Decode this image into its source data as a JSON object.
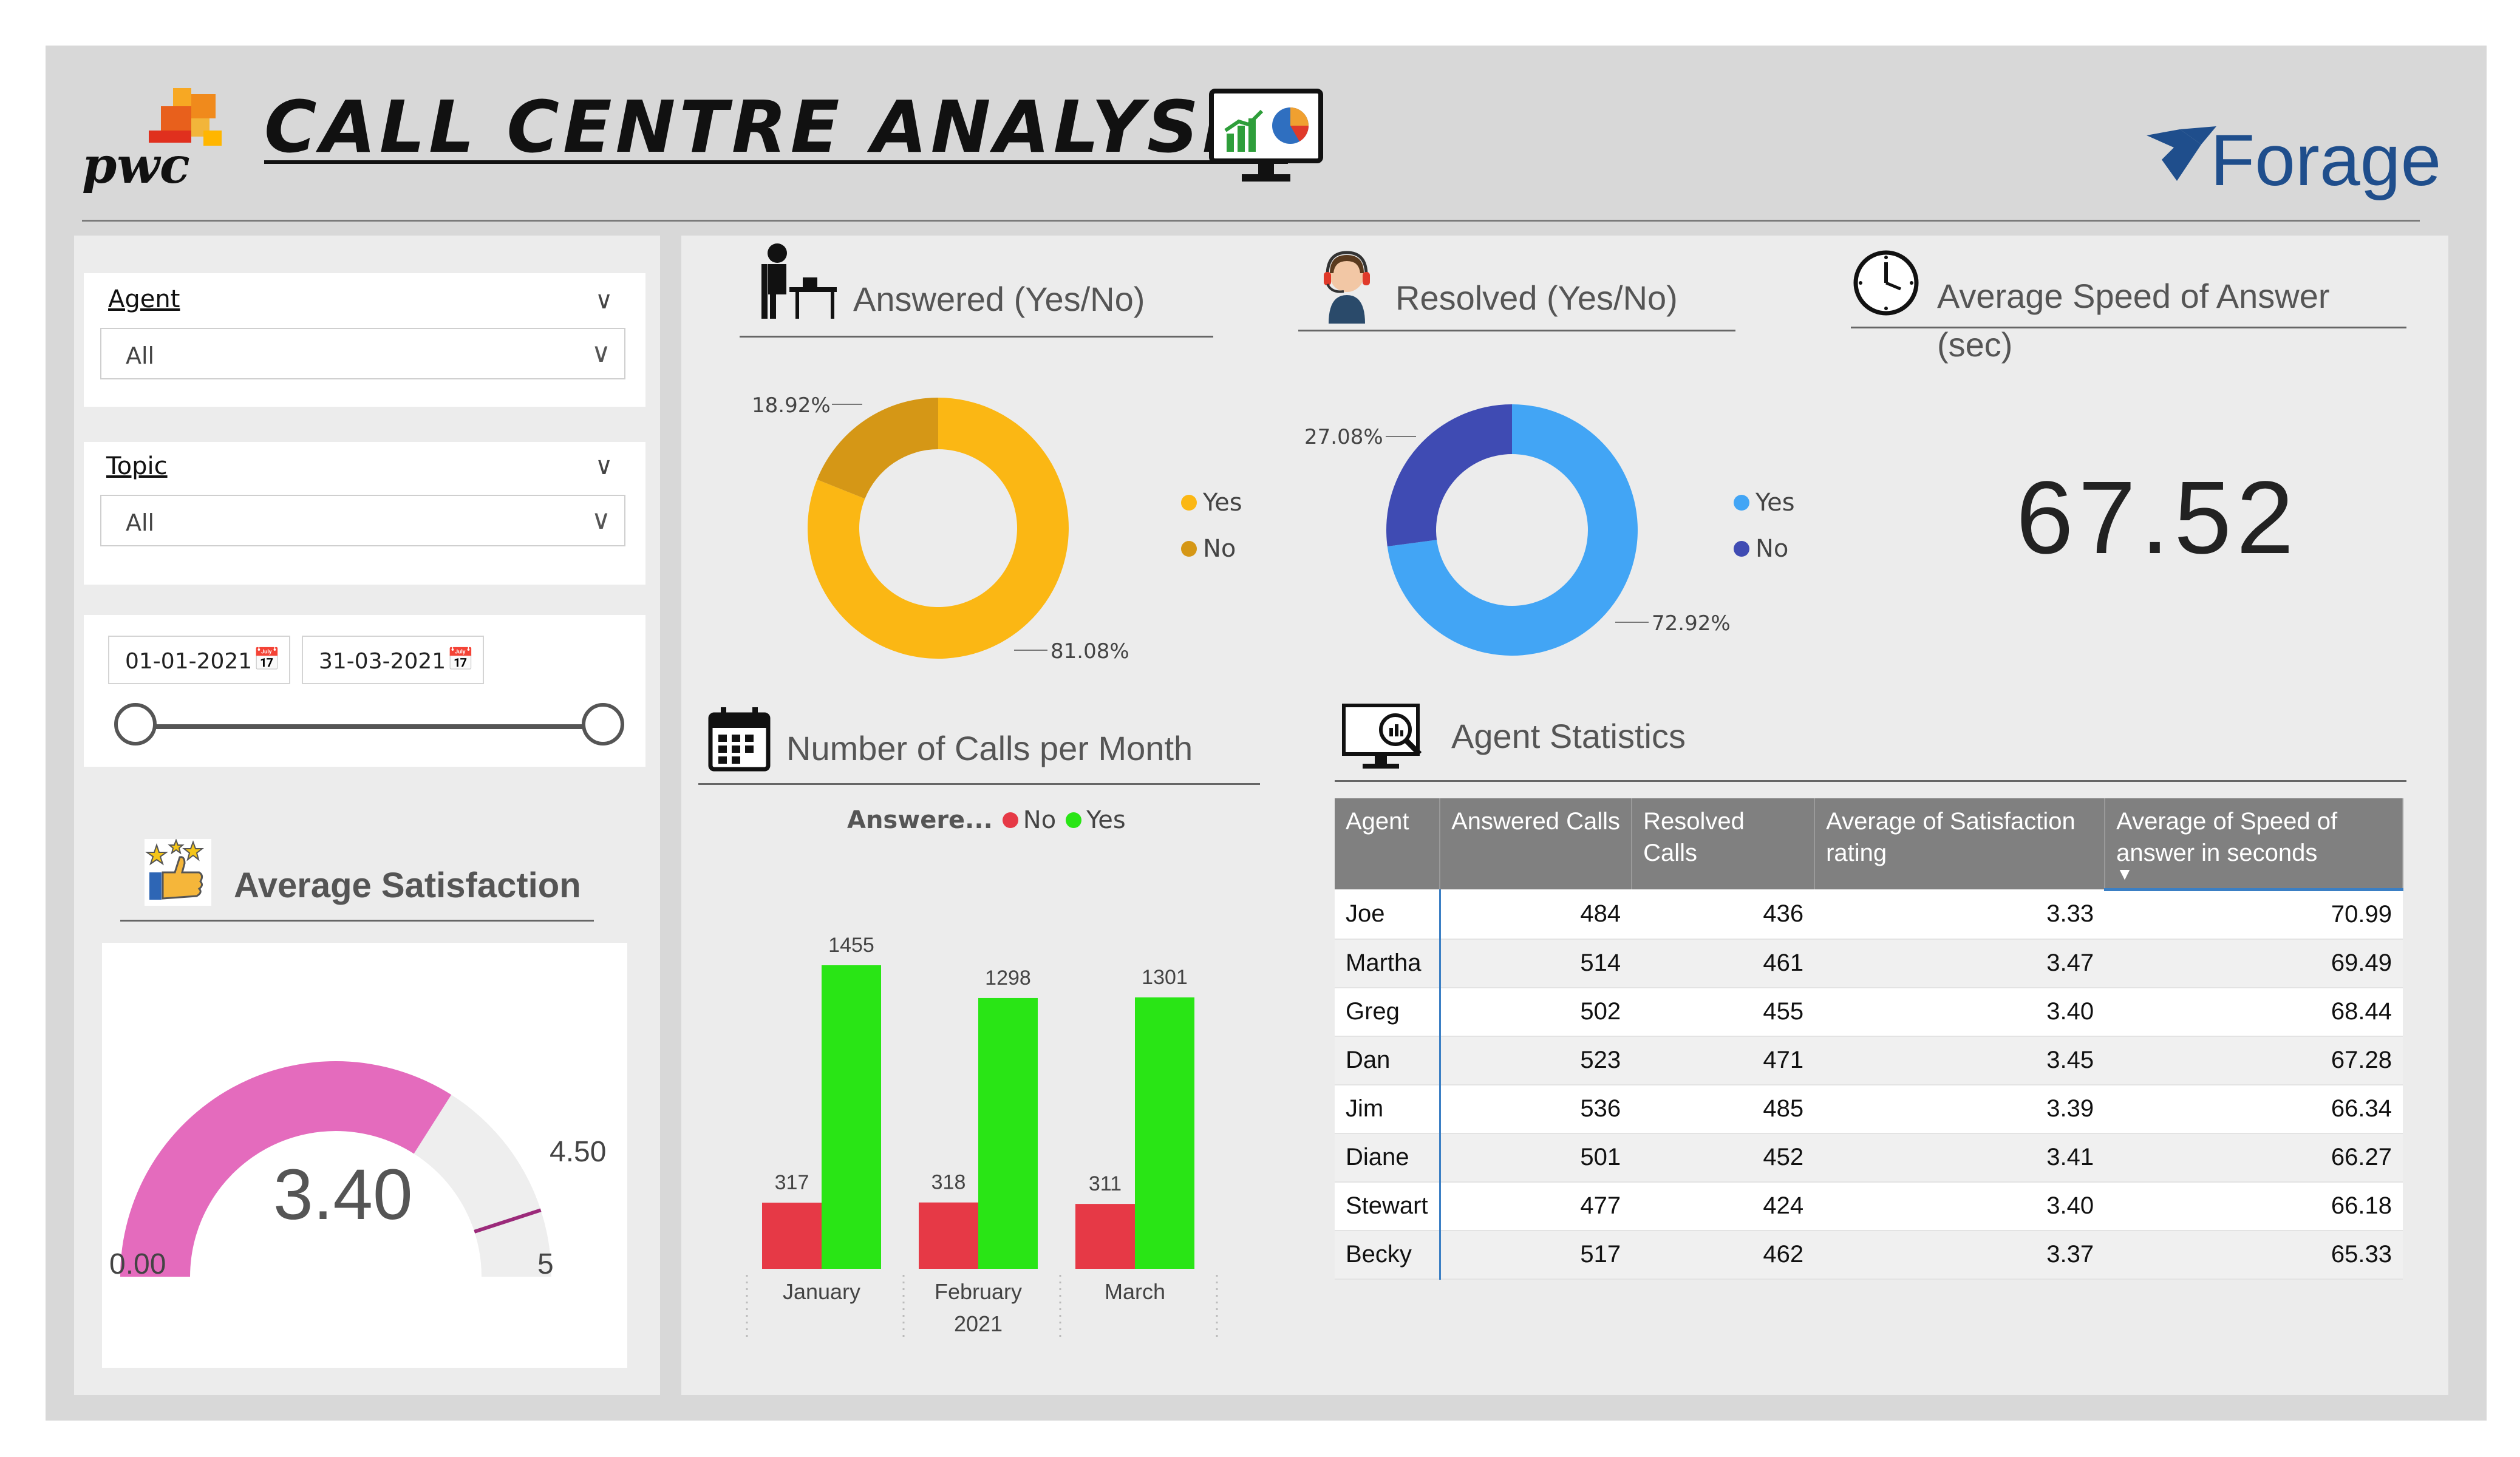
{
  "header": {
    "logo_left": "pwc",
    "title": "CALL CENTRE ANALYSIS",
    "logo_right": "Forage"
  },
  "filters": {
    "agent": {
      "label": "Agent",
      "value": "All"
    },
    "topic": {
      "label": "Topic",
      "value": "All"
    },
    "date_range": {
      "start": "01-01-2021",
      "end": "31-03-2021"
    }
  },
  "satisfaction": {
    "title": "Average Satisfaction",
    "value": "3.40",
    "min": "0.00",
    "max": "5",
    "target": "4.50",
    "value_fraction": 0.68,
    "target_fraction": 0.9,
    "fill_color": "#e46bbd"
  },
  "answered": {
    "title": "Answered (Yes/No)",
    "legend": [
      {
        "label": "Yes",
        "color": "#fbb714"
      },
      {
        "label": "No",
        "color": "#d59716"
      }
    ],
    "labels": {
      "no": "18.92%",
      "yes": "81.08%"
    }
  },
  "resolved": {
    "title": "Resolved (Yes/No)",
    "legend": [
      {
        "label": "Yes",
        "color": "#42a5f5"
      },
      {
        "label": "No",
        "color": "#3f4bb3"
      }
    ],
    "labels": {
      "no": "27.08%",
      "yes": "72.92%"
    }
  },
  "speed": {
    "title": "Average Speed of Answer (sec)",
    "value": "67.52"
  },
  "calls": {
    "title": "Number of Calls per  Month",
    "legend_title": "Answere...",
    "legend": [
      {
        "label": "No",
        "color": "#e63946"
      },
      {
        "label": "Yes",
        "color": "#29e515"
      }
    ],
    "year_label": "2021"
  },
  "agent_stats": {
    "title": "Agent Statistics",
    "columns": [
      "Agent",
      "Answered Calls",
      "Resolved Calls",
      "Average of Satisfaction rating",
      "Average of Speed of answer in seconds"
    ],
    "rows": [
      [
        "Joe",
        "484",
        "436",
        "3.33",
        "70.99"
      ],
      [
        "Martha",
        "514",
        "461",
        "3.47",
        "69.49"
      ],
      [
        "Greg",
        "502",
        "455",
        "3.40",
        "68.44"
      ],
      [
        "Dan",
        "523",
        "471",
        "3.45",
        "67.28"
      ],
      [
        "Jim",
        "536",
        "485",
        "3.39",
        "66.34"
      ],
      [
        "Diane",
        "501",
        "452",
        "3.41",
        "66.27"
      ],
      [
        "Stewart",
        "477",
        "424",
        "3.40",
        "66.18"
      ],
      [
        "Becky",
        "517",
        "462",
        "3.37",
        "65.33"
      ]
    ]
  },
  "chart_data": [
    {
      "type": "pie",
      "title": "Answered (Yes/No)",
      "categories": [
        "Yes",
        "No"
      ],
      "values": [
        81.08,
        18.92
      ]
    },
    {
      "type": "pie",
      "title": "Resolved (Yes/No)",
      "categories": [
        "Yes",
        "No"
      ],
      "values": [
        72.92,
        27.08
      ]
    },
    {
      "type": "bar",
      "title": "Number of Calls per  Month",
      "categories": [
        "January",
        "February",
        "March"
      ],
      "series": [
        {
          "name": "No",
          "values": [
            317,
            318,
            311
          ]
        },
        {
          "name": "Yes",
          "values": [
            1455,
            1298,
            1301
          ]
        }
      ],
      "ylim": [
        0,
        1455
      ]
    }
  ]
}
